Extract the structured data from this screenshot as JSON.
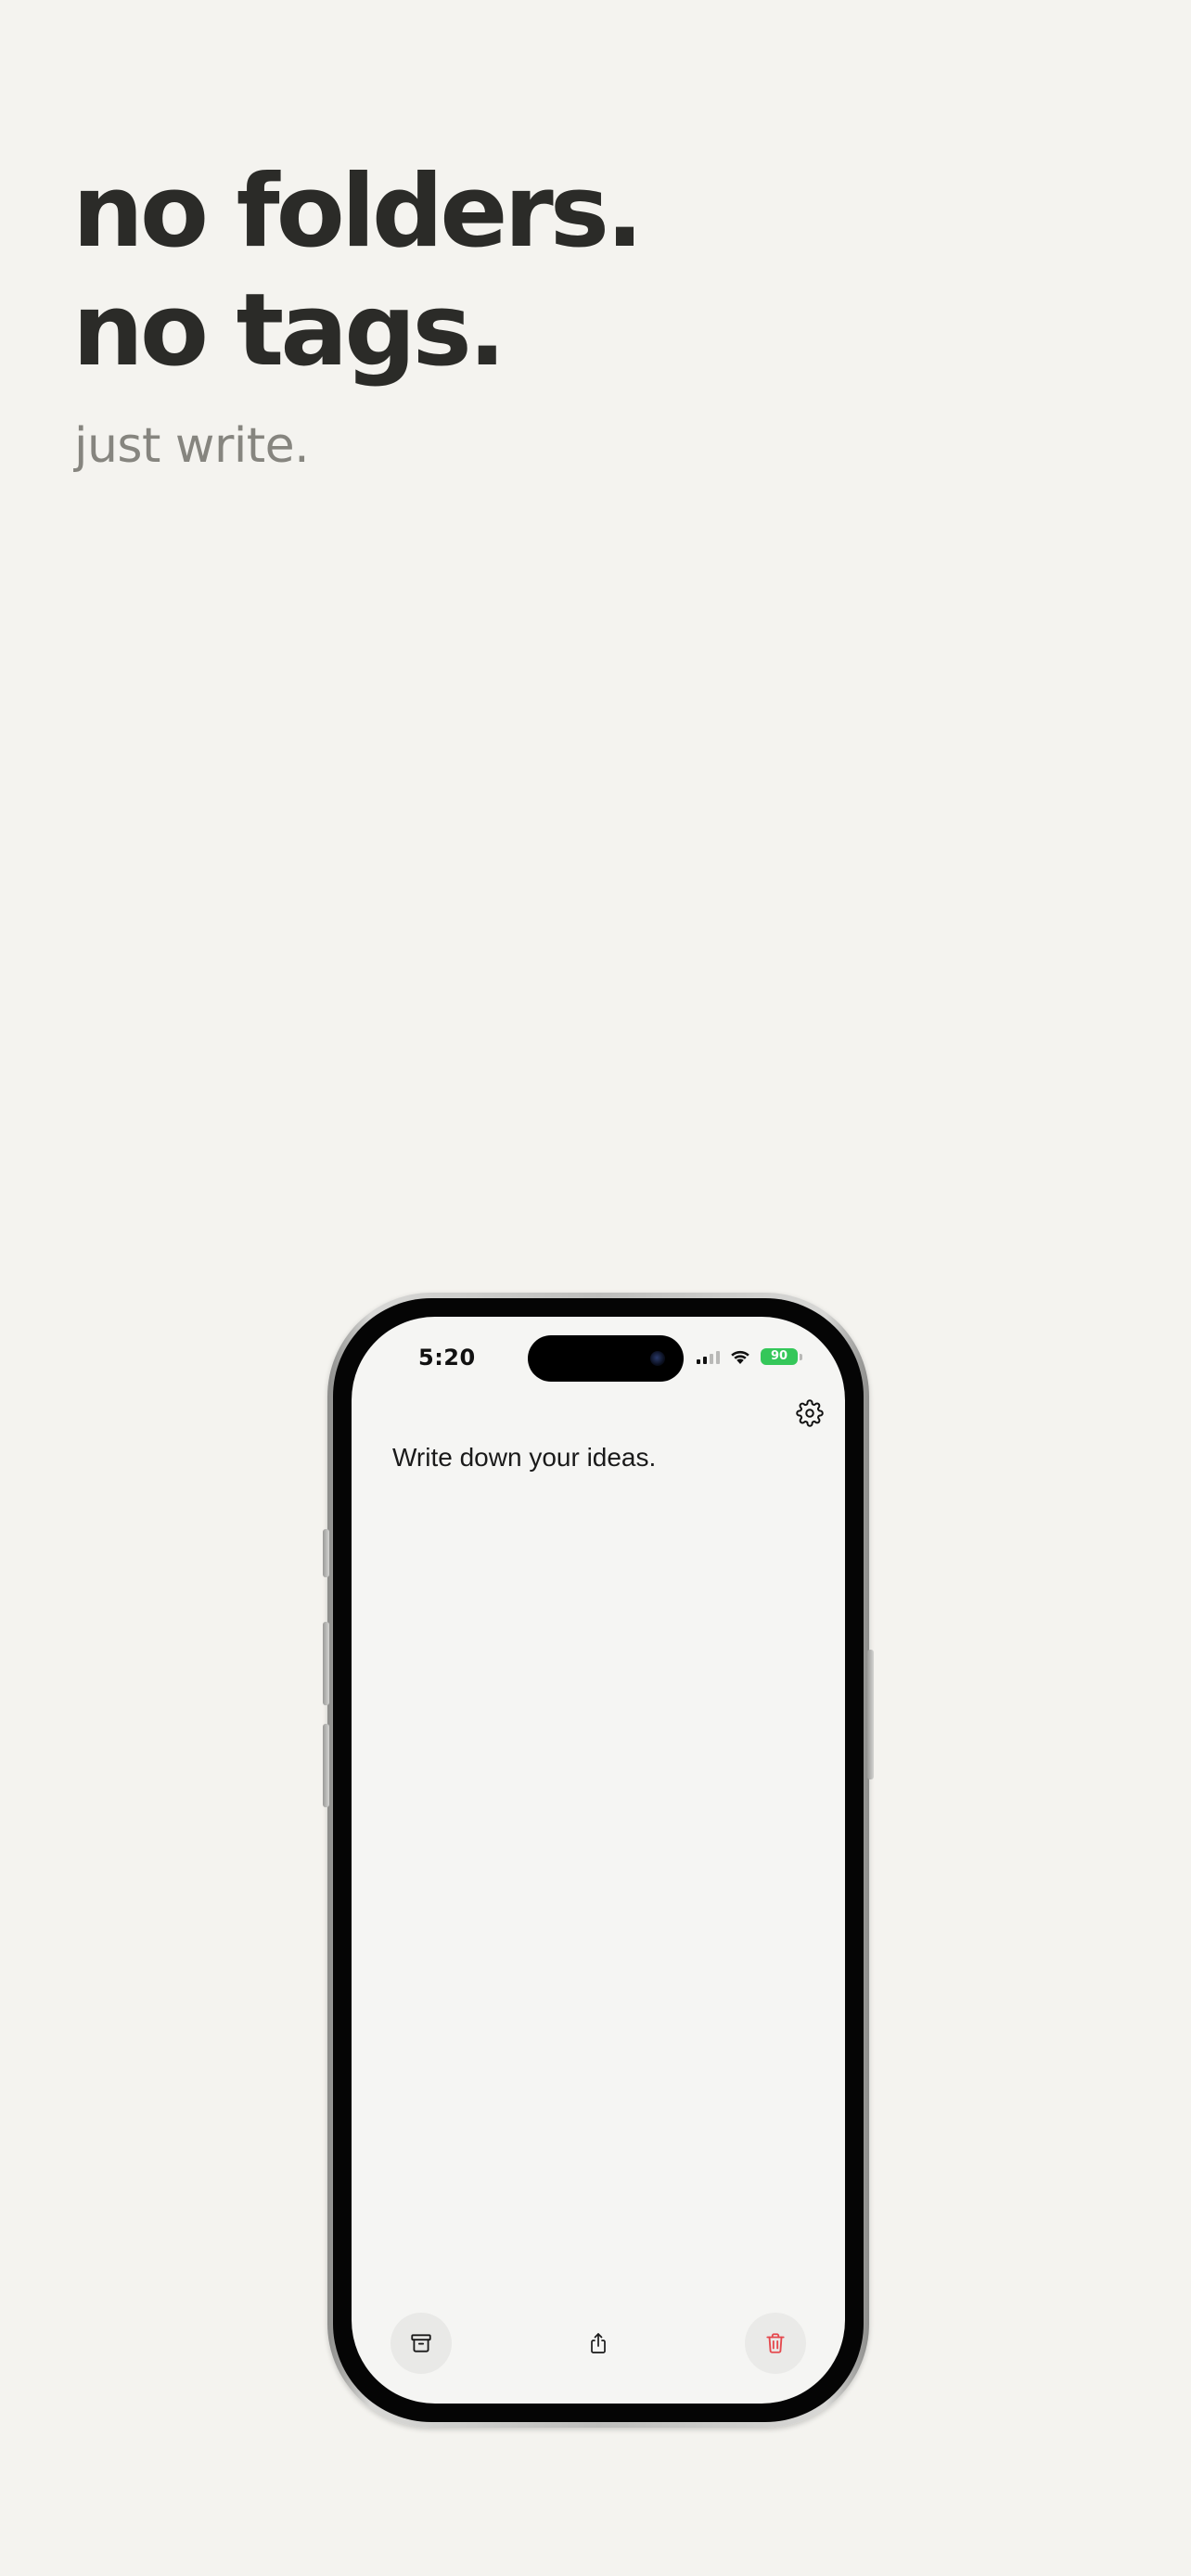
{
  "headline": {
    "line1": "no folders.",
    "line2": "no tags."
  },
  "tagline": "just write.",
  "phone": {
    "status_bar": {
      "time": "5:20",
      "battery_level": "90",
      "battery_color": "#34c759",
      "icons": [
        "signal-icon",
        "wifi-icon",
        "battery-icon"
      ]
    },
    "toolbar": {
      "settings_icon": "gear-icon"
    },
    "note": {
      "placeholder": "Write down your ideas."
    },
    "bottom_bar": {
      "archive_icon": "archive-icon",
      "share_icon": "share-icon",
      "delete_icon": "trash-icon",
      "delete_color": "#e5484d"
    }
  }
}
